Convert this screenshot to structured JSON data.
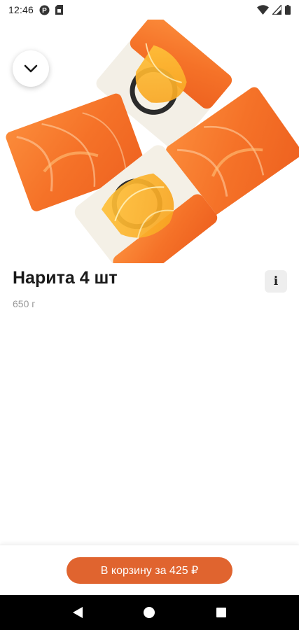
{
  "status_bar": {
    "time": "12:46",
    "icons_left": [
      "p-circle-icon",
      "sim-card-icon"
    ],
    "icons_right": [
      "wifi-icon",
      "signal-icon",
      "battery-icon"
    ]
  },
  "product": {
    "image_alt": "Нарита 4 шт",
    "title": "Нарита 4 шт",
    "weight": "650 г",
    "info_label": "i"
  },
  "cart": {
    "button_label": "В корзину за 425 ₽"
  },
  "colors": {
    "accent": "#e0642f",
    "salmon": "#f47a2e",
    "background": "#ffffff"
  }
}
